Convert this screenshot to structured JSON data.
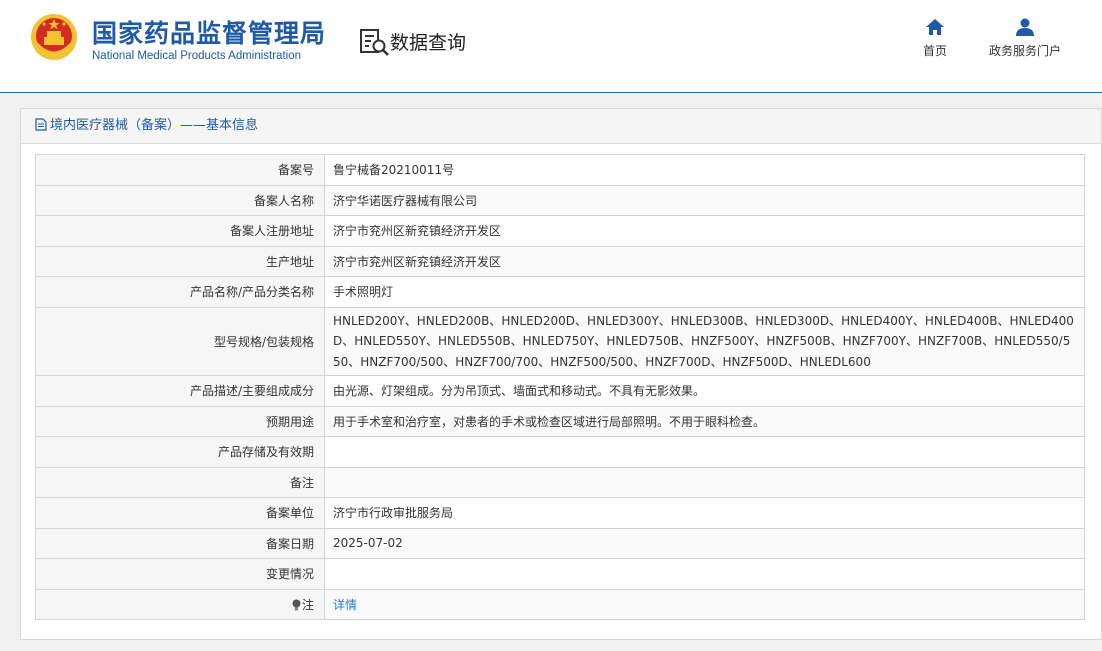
{
  "header": {
    "agency_cn": "国家药品监督管理局",
    "agency_en": "National Medical Products Administration",
    "query_title": "数据查询",
    "nav": [
      {
        "label": "首页",
        "icon": "home-icon"
      },
      {
        "label": "政务服务门户",
        "icon": "user-icon"
      }
    ],
    "colors": {
      "brand": "#1f5aa6",
      "emblem_red": "#d62b20",
      "emblem_gold": "#f2c230"
    }
  },
  "panel": {
    "title": "境内医疗器械（备案）——基本信息",
    "rows": [
      {
        "label": "备案号",
        "value": "鲁宁械备20210011号"
      },
      {
        "label": "备案人名称",
        "value": "济宁华诺医疗器械有限公司"
      },
      {
        "label": "备案人注册地址",
        "value": "济宁市兖州区新兖镇经济开发区"
      },
      {
        "label": "生产地址",
        "value": "济宁市兖州区新兖镇经济开发区"
      },
      {
        "label": "产品名称/产品分类名称",
        "value": "手术照明灯"
      },
      {
        "label": "型号规格/包装规格",
        "value": "HNLED200Y、HNLED200B、HNLED200D、HNLED300Y、HNLED300B、HNLED300D、HNLED400Y、HNLED400B、HNLED400D、HNLED550Y、HNLED550B、HNLED750Y、HNLED750B、HNZF500Y、HNZF500B、HNZF700Y、HNZF700B、HNLED550/550、HNZF700/500、HNZF700/700、HNZF500/500、HNZF700D、HNZF500D、HNLEDL600"
      },
      {
        "label": "产品描述/主要组成成分",
        "value": "由光源、灯架组成。分为吊顶式、墙面式和移动式。不具有无影效果。"
      },
      {
        "label": "预期用途",
        "value": "用于手术室和治疗室，对患者的手术或检查区域进行局部照明。不用于眼科检查。"
      },
      {
        "label": "产品存储及有效期",
        "value": ""
      },
      {
        "label": "备注",
        "value": ""
      },
      {
        "label": "备案单位",
        "value": "济宁市行政审批服务局"
      },
      {
        "label": "备案日期",
        "value": "2025-07-02"
      },
      {
        "label": "变更情况",
        "value": ""
      }
    ],
    "note_row": {
      "label": "注",
      "link": "详情",
      "icon": "bulb-icon",
      "link_color": "#2a7ad2"
    }
  }
}
